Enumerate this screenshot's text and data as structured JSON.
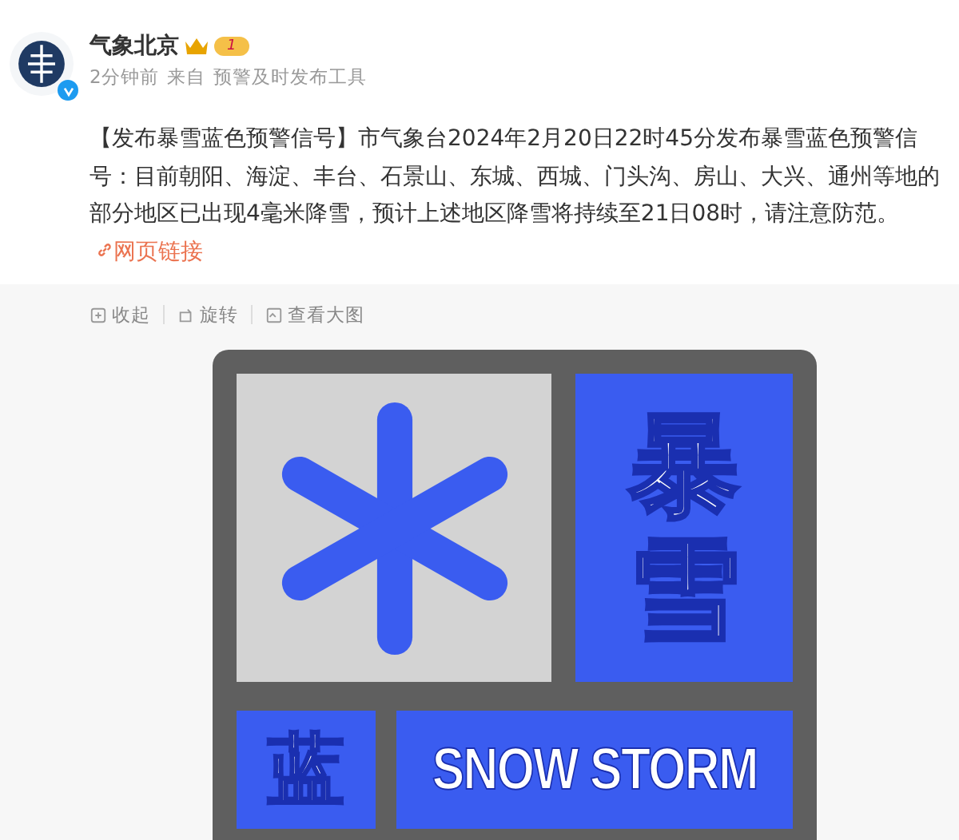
{
  "post": {
    "author": "气象北京",
    "badge": "1",
    "time": "2分钟前",
    "source_prefix": "来自",
    "source": "预警及时发布工具",
    "verified": true,
    "text": "【发布暴雪蓝色预警信号】市气象台2024年2月20日22时45分发布暴雪蓝色预警信号：目前朝阳、海淀、丰台、石景山、东城、西城、门头沟、房山、大兴、通州等地的部分地区已出现4毫米降雪，预计上述地区降雪将持续至21日08时，请注意防范。",
    "link": "网页链接"
  },
  "toolbar": [
    {
      "kind": "collapse",
      "label": "收起"
    },
    {
      "kind": "rotate",
      "label": "旋转"
    },
    {
      "kind": "zoom",
      "label": "查看大图"
    }
  ],
  "warning_sign": {
    "title": "暴雪",
    "level_label": "蓝",
    "english": "SNOW STORM"
  }
}
